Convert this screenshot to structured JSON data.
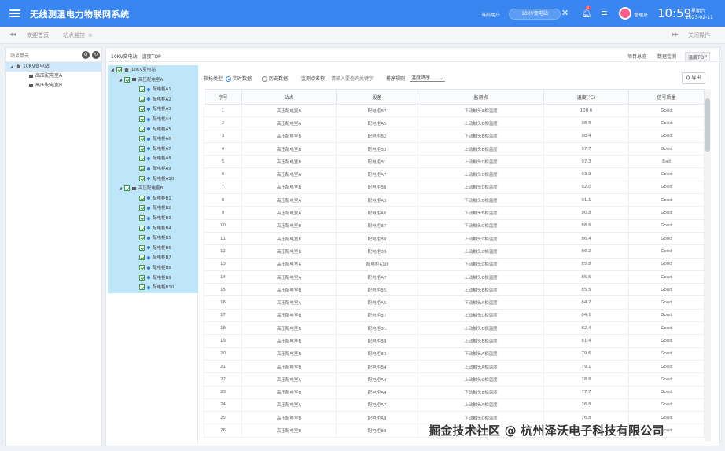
{
  "app": {
    "title": "无线测温电力物联网系统",
    "current_label": "当前用户",
    "station_pill": "10KV变电站",
    "user_name": "管理员",
    "clock": "10:59",
    "weekday": "星期六",
    "date": "2023-02-11",
    "notification_count": "1"
  },
  "icons": {
    "menu": "hamburger-icon",
    "fullscreen": "fullscreen-icon",
    "bell": "bell-icon",
    "list": "list-icon"
  },
  "tabs": {
    "nav_back": "◂◂",
    "home": "欢迎首页",
    "active": "站点监控",
    "close": "⊗",
    "nav_fwd": "▸▸",
    "close_ops": "关闭操作"
  },
  "left_panel": {
    "title": "站点单元",
    "root": "10KV变电站",
    "children": [
      "高压配电室A",
      "高压配电室B"
    ]
  },
  "main": {
    "breadcrumb": "10KV变电站 - 温度TOP",
    "view_tabs": [
      "项目总览",
      "数据监测",
      "温度TOP"
    ],
    "filters": {
      "data_type_label": "指标类型",
      "realtime": "实时数据",
      "history": "历史数据",
      "monitor_label": "监测点名称",
      "monitor_placeholder": "请输入要查询关键字",
      "sort_label": "排序规则",
      "sort_value": "温度降序"
    },
    "export": "Q 导出"
  },
  "tree2": {
    "root": "10KV变电站",
    "group_a": "高压配电室A",
    "cabinets_a": [
      "配电柜A1",
      "配电柜A2",
      "配电柜A3",
      "配电柜A4",
      "配电柜A5",
      "配电柜A6",
      "配电柜A7",
      "配电柜A8",
      "配电柜A9",
      "配电柜A10"
    ],
    "group_b": "高压配电室B",
    "cabinets_b": [
      "配电柜B1",
      "配电柜B2",
      "配电柜B3",
      "配电柜B4",
      "配电柜B5",
      "配电柜B6",
      "配电柜B7",
      "配电柜B8",
      "配电柜B9",
      "配电柜B10"
    ]
  },
  "table": {
    "headers": [
      "序号",
      "站点",
      "设备",
      "监测点",
      "温度(℃)",
      "信号质量"
    ],
    "rows": [
      [
        "1",
        "高压配电室B",
        "配电柜B7",
        "下动触头A相温度",
        "100.6",
        "Good"
      ],
      [
        "2",
        "高压配电室A",
        "配电柜A5",
        "上动触头B相温度",
        "98.5",
        "Good"
      ],
      [
        "3",
        "高压配电室B",
        "配电柜B2",
        "下动触头B相温度",
        "98.4",
        "Good"
      ],
      [
        "4",
        "高压配电室B",
        "配电柜B3",
        "上动触头B相温度",
        "97.7",
        "Good"
      ],
      [
        "5",
        "高压配电室B",
        "配电柜B1",
        "上动触头C相温度",
        "97.3",
        "Bad"
      ],
      [
        "6",
        "高压配电室A",
        "配电柜A7",
        "上动触头C相温度",
        "93.9",
        "Good"
      ],
      [
        "7",
        "高压配电室B",
        "配电柜B6",
        "上动触头C相温度",
        "92.0",
        "Good"
      ],
      [
        "8",
        "高压配电室A",
        "配电柜A3",
        "下动触头B相温度",
        "91.1",
        "Good"
      ],
      [
        "9",
        "高压配电室A",
        "配电柜A6",
        "下动触头B相温度",
        "90.8",
        "Good"
      ],
      [
        "10",
        "高压配电室B",
        "配电柜B7",
        "下动触头C相温度",
        "88.6",
        "Good"
      ],
      [
        "11",
        "高压配电室B",
        "配电柜B8",
        "上动触头C相温度",
        "86.4",
        "Good"
      ],
      [
        "12",
        "高压配电室B",
        "配电柜B9",
        "上动触头C相温度",
        "86.2",
        "Good"
      ],
      [
        "13",
        "高压配电室A",
        "配电柜A10",
        "下动触头C相温度",
        "85.8",
        "Good"
      ],
      [
        "14",
        "高压配电室A",
        "配电柜A7",
        "上动触头B相温度",
        "85.5",
        "Good"
      ],
      [
        "15",
        "高压配电室B",
        "配电柜B5",
        "上动触头B相温度",
        "85.5",
        "Good"
      ],
      [
        "16",
        "高压配电室A",
        "配电柜A5",
        "下动触头A相温度",
        "84.7",
        "Good"
      ],
      [
        "17",
        "高压配电室B",
        "配电柜B7",
        "上动触头C相温度",
        "84.1",
        "Good"
      ],
      [
        "18",
        "高压配电室B",
        "配电柜B1",
        "上动触头B相温度",
        "82.4",
        "Good"
      ],
      [
        "19",
        "高压配电室B",
        "配电柜B9",
        "上动触头B相温度",
        "81.4",
        "Good"
      ],
      [
        "20",
        "高压配电室B",
        "配电柜B3",
        "下动触头A相温度",
        "79.6",
        "Good"
      ],
      [
        "21",
        "高压配电室B",
        "配电柜B4",
        "上动触头A相温度",
        "79.1",
        "Good"
      ],
      [
        "22",
        "高压配电室A",
        "配电柜A4",
        "上动触头C相温度",
        "78.6",
        "Good"
      ],
      [
        "23",
        "高压配电室B",
        "配电柜A4",
        "下动触头B相温度",
        "77.7",
        "Good"
      ],
      [
        "24",
        "高压配电室A",
        "配电柜A7",
        "上动触头A相温度",
        "76.8",
        "Good"
      ],
      [
        "25",
        "高压配电室B",
        "配电柜A9",
        "下动触头C相温度",
        "76.8",
        "Good"
      ],
      [
        "26",
        "高压配电室B",
        "配电柜B9",
        "下动触头A相温度",
        "76.4",
        "Good"
      ]
    ]
  },
  "watermark": "掘金技术社区 @ 杭州泽沃电子科技有限公司"
}
